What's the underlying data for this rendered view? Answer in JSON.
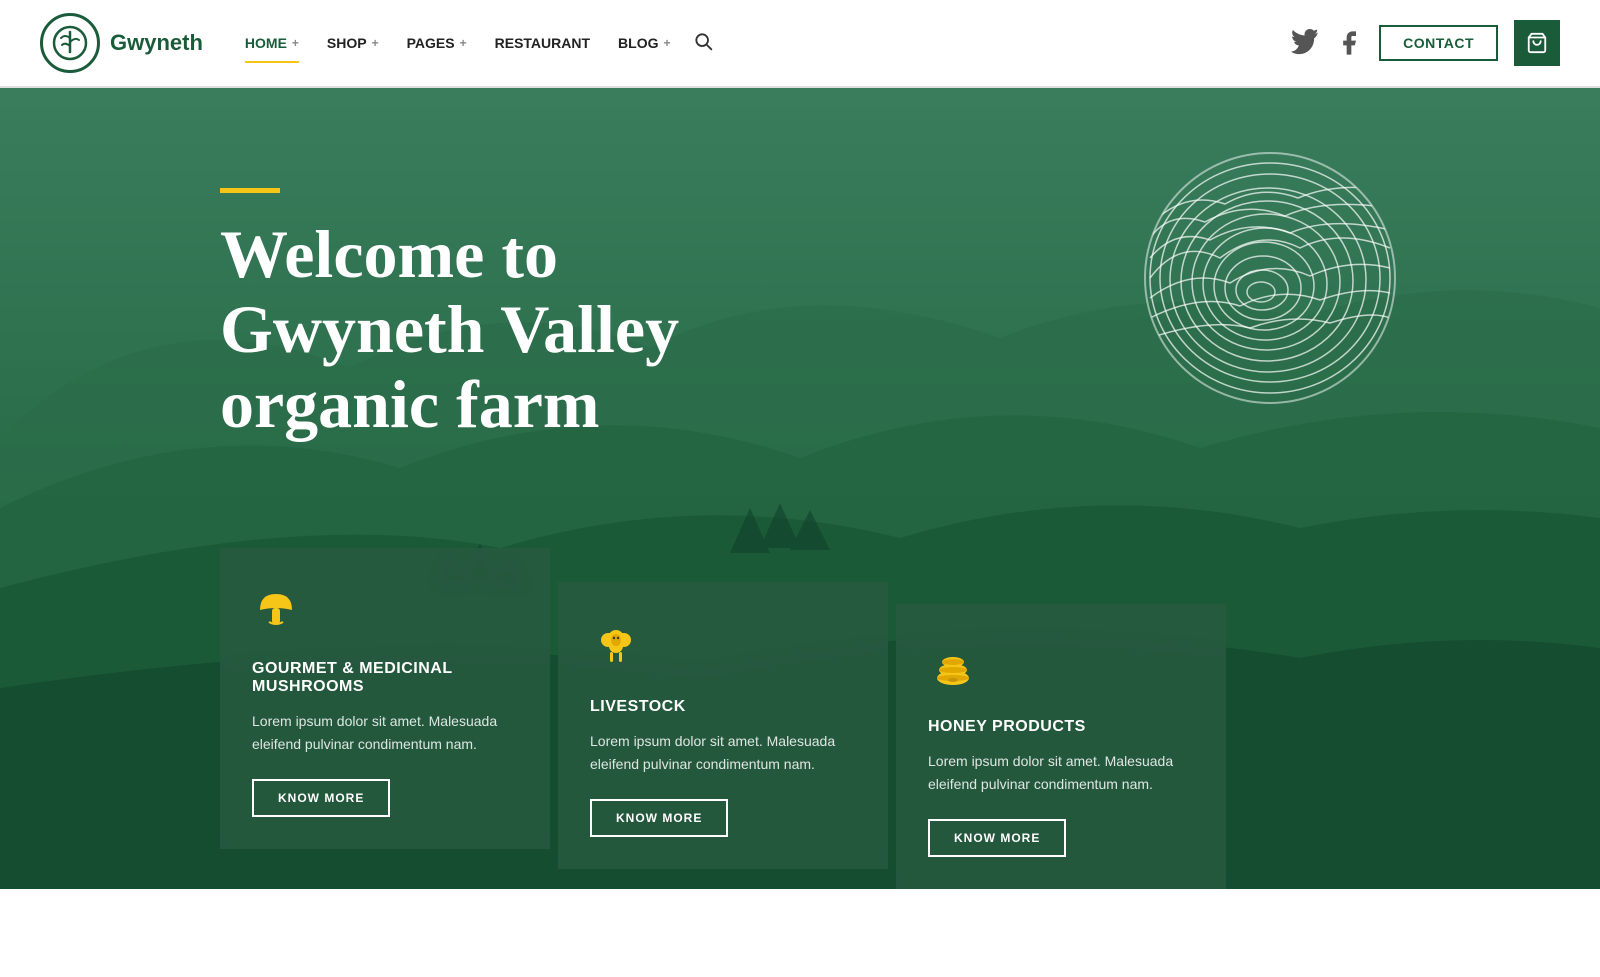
{
  "brand": {
    "name": "Gwyneth",
    "logo_alt": "Gwyneth logo"
  },
  "nav": {
    "items": [
      {
        "label": "HOME",
        "id": "home",
        "active": true,
        "has_dropdown": true
      },
      {
        "label": "SHOP",
        "id": "shop",
        "active": false,
        "has_dropdown": true
      },
      {
        "label": "PAGES",
        "id": "pages",
        "active": false,
        "has_dropdown": true
      },
      {
        "label": "RESTAURANT",
        "id": "restaurant",
        "active": false,
        "has_dropdown": false
      },
      {
        "label": "BLOG",
        "id": "blog",
        "active": false,
        "has_dropdown": true
      }
    ],
    "search_aria": "Search",
    "contact_label": "CONTACT",
    "cart_aria": "Cart"
  },
  "hero": {
    "accent": "#f5c518",
    "title_line1": "Welcome to",
    "title_line2": "Gwyneth Valley",
    "title_line3": "organic farm"
  },
  "cards": [
    {
      "id": "mushrooms",
      "icon": "mushroom",
      "title": "GOURMET & MEDICINAL MUSHROOMS",
      "description": "Lorem ipsum dolor sit amet. Malesuada eleifend pulvinar condimentum nam.",
      "button_label": "KNOW MORE"
    },
    {
      "id": "livestock",
      "icon": "sheep",
      "title": "LIVESTOCK",
      "description": "Lorem ipsum dolor sit amet. Malesuada eleifend pulvinar condimentum nam.",
      "button_label": "KNOW MORE"
    },
    {
      "id": "honey",
      "icon": "honey",
      "title": "HONEY PRODUCTS",
      "description": "Lorem ipsum dolor sit amet. Malesuada eleifend pulvinar condimentum nam.",
      "button_label": "KNOW MORE"
    }
  ],
  "colors": {
    "brand_green": "#1a5c3a",
    "accent_yellow": "#f5c518",
    "hero_overlay": "rgba(20,70,50,0.55)"
  }
}
